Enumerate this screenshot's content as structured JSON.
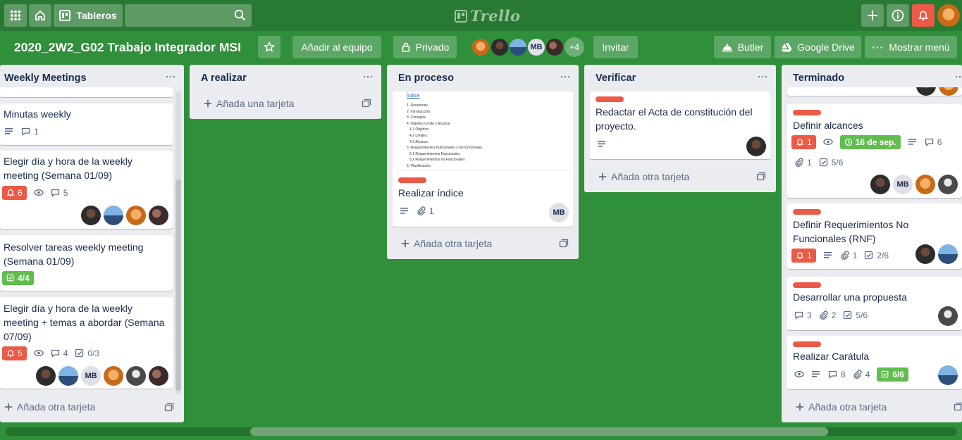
{
  "nav": {
    "boards_label": "Tableros",
    "logo": "Trello"
  },
  "board": {
    "title": "2020_2W2_G02 Trabajo Integrador MSI",
    "add_team": "Añadir al equipo",
    "privacy": "Privado",
    "members_initials": "MB",
    "more_members": "+4",
    "invite": "Invitar",
    "butler": "Butler",
    "drive": "Google Drive",
    "menu": "Mostrar menú"
  },
  "lists": {
    "weekly": {
      "title": "Weekly Meetings",
      "cards": [
        {
          "title": "Minutas weekly",
          "comments": "1"
        },
        {
          "title": "Elegir día y hora de la weekly meeting (Semana 01/09)",
          "notif": "6",
          "comments": "5"
        },
        {
          "title": "Resolver tareas weekly meeting (Semana 01/09)",
          "checklist": "4/4"
        },
        {
          "title": "Elegir día y hora de la weekly meeting + temas a abordar (Semana 07/09)",
          "notif": "5",
          "comments": "4",
          "checklist": "0/3"
        }
      ],
      "add": "Añada otra tarjeta"
    },
    "todo": {
      "title": "A realizar",
      "add": "Añada una tarjeta"
    },
    "doing": {
      "title": "En proceso",
      "cover": {
        "heading": "Índice",
        "entries": [
          "1.  Revisiones",
          "2.  Introducción:",
          "3.  Consigna",
          "4.  Objetivo Límite y Alcance",
          "4.1 Objetivo:",
          "4.2 Límites:",
          "4.3 Alcance:",
          "5.  Requerimientos Funcionales y No funcionales",
          "5.1  Requerimientos Funcionales",
          "5.2  Requerimientos no Funcionales",
          "6.  Planificación:"
        ]
      },
      "card": {
        "title": "Realizar índice",
        "attachments": "1",
        "member": "MB"
      },
      "add": "Añada otra tarjeta"
    },
    "verify": {
      "title": "Verificar",
      "card": {
        "title": "Redactar el Acta de constitución del proyecto."
      },
      "add": "Añada otra tarjeta"
    },
    "done": {
      "title": "Terminado",
      "cards": [
        {
          "title": "Definir alcances",
          "notif": "1",
          "due": "16 de sep.",
          "comments": "6",
          "attachments": "1",
          "checklist": "5/6",
          "member": "MB"
        },
        {
          "title": "Definir Requerimientos No Funcionales (RNF)",
          "notif": "1",
          "attachments": "1",
          "checklist": "2/6"
        },
        {
          "title": "Desarrollar una propuesta",
          "comments": "3",
          "attachments": "2",
          "checklist": "5/6"
        },
        {
          "title": "Realizar Carátula",
          "comments": "8",
          "attachments": "4",
          "checklist": "6/6"
        }
      ],
      "add": "Añada otra tarjeta"
    }
  },
  "colors": {
    "board_bg": "#2f8f3a",
    "label_red": "#eb5a46",
    "badge_green": "#61bd4f",
    "notif_red": "#eb5a46"
  }
}
